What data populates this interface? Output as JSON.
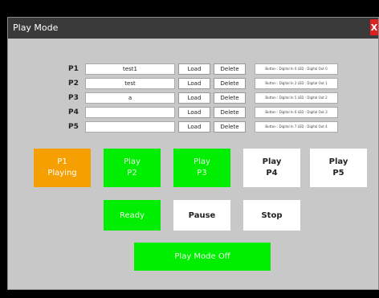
{
  "window": {
    "title": "Play Mode",
    "close_label": "X"
  },
  "presets": [
    {
      "label": "P1",
      "value": "test1",
      "load": "Load",
      "delete": "Delete",
      "info": "Button : Digital In 0   LED : Digital Out 0"
    },
    {
      "label": "P2",
      "value": "test",
      "load": "Load",
      "delete": "Delete",
      "info": "Button : Digital In 2   LED : Digital Out 1"
    },
    {
      "label": "P3",
      "value": "a",
      "load": "Load",
      "delete": "Delete",
      "info": "Button : Digital In 5   LED : Digital Out 2"
    },
    {
      "label": "P4",
      "value": "",
      "load": "Load",
      "delete": "Delete",
      "info": "Button : Digital In 6   LED : Digital Out 3"
    },
    {
      "label": "P5",
      "value": "",
      "load": "Load",
      "delete": "Delete",
      "info": "Button : Digital In 7   LED : Digital Out 4"
    }
  ],
  "play_buttons": [
    {
      "line1": "P1",
      "line2": "Playing",
      "state": "playing"
    },
    {
      "line1": "Play",
      "line2": "P2",
      "state": "ready"
    },
    {
      "line1": "Play",
      "line2": "P3",
      "state": "ready"
    },
    {
      "line1": "Play",
      "line2": "P4",
      "state": "empty"
    },
    {
      "line1": "Play",
      "line2": "P5",
      "state": "empty"
    }
  ],
  "controls": {
    "ready": "Ready",
    "pause": "Pause",
    "stop": "Stop"
  },
  "play_mode_off": "Play Mode Off",
  "colors": {
    "playing": "#f5a000",
    "active": "#00ee00",
    "inactive": "#ffffff",
    "panel": "#c8c8c8",
    "titlebar": "#3a3a3a",
    "close": "#e02020"
  }
}
